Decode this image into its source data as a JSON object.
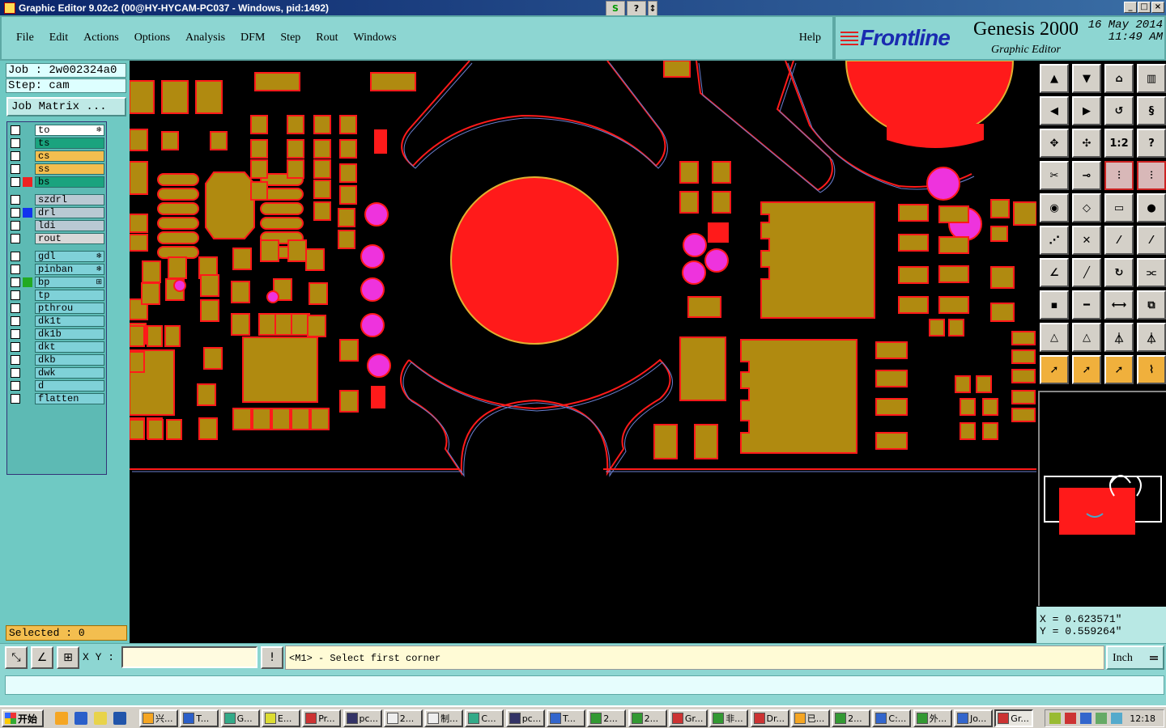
{
  "window": {
    "title": "Graphic Editor 9.02c2 (00@HY-HYCAM-PC037 - Windows, pid:1492)",
    "tools": [
      "S",
      "?",
      "↕"
    ],
    "controls": [
      "_",
      "□",
      "×"
    ]
  },
  "menu": {
    "items": [
      "File",
      "Edit",
      "Actions",
      "Options",
      "Analysis",
      "DFM",
      "Step",
      "Rout",
      "Windows"
    ],
    "help": "Help"
  },
  "brand": {
    "logo": "Frontline",
    "product": "Genesis 2000",
    "subtitle": "Graphic Editor",
    "date": "16 May 2014",
    "time": "11:49 AM"
  },
  "job": {
    "job_line": "Job : 2w002324a0",
    "step_line": "Step: cam",
    "matrix_button": "Job Matrix ..."
  },
  "layers": {
    "group1": [
      {
        "name": "to",
        "color": "#ffffff",
        "mark": "",
        "glyph": "❄"
      },
      {
        "name": "ts",
        "color": "#1aa37e",
        "mark": "",
        "glyph": ""
      },
      {
        "name": "cs",
        "color": "#f3be4f",
        "mark": "",
        "glyph": ""
      },
      {
        "name": "ss",
        "color": "#f3be4f",
        "mark": "",
        "glyph": ""
      },
      {
        "name": "bs",
        "color": "#1aa37e",
        "mark": "#ee2222",
        "glyph": ""
      }
    ],
    "group2": [
      {
        "name": "szdrl",
        "color": "#b9c9d3",
        "mark": "",
        "glyph": ""
      },
      {
        "name": "drl",
        "color": "#b9c9d3",
        "mark": "#1133ee",
        "glyph": ""
      },
      {
        "name": "ldi",
        "color": "#b9c9d3",
        "mark": "",
        "glyph": ""
      },
      {
        "name": "rout",
        "color": "#d8d8d8",
        "mark": "",
        "glyph": ""
      }
    ],
    "group3": [
      {
        "name": "gdl",
        "color": "#7fd1d8",
        "mark": "",
        "glyph": "❄"
      },
      {
        "name": "pinban",
        "color": "#7fd1d8",
        "mark": "",
        "glyph": "❄"
      },
      {
        "name": "bp",
        "color": "#7fd1d8",
        "mark": "#22aa22",
        "glyph": "⊞"
      },
      {
        "name": "tp",
        "color": "#7fd1d8",
        "mark": "",
        "glyph": ""
      },
      {
        "name": "pthrou",
        "color": "#7fd1d8",
        "mark": "",
        "glyph": ""
      },
      {
        "name": "dk1t",
        "color": "#7fd1d8",
        "mark": "",
        "glyph": ""
      },
      {
        "name": "dk1b",
        "color": "#7fd1d8",
        "mark": "",
        "glyph": ""
      },
      {
        "name": "dkt",
        "color": "#7fd1d8",
        "mark": "",
        "glyph": ""
      },
      {
        "name": "dkb",
        "color": "#7fd1d8",
        "mark": "",
        "glyph": ""
      },
      {
        "name": "dwk",
        "color": "#7fd1d8",
        "mark": "",
        "glyph": ""
      },
      {
        "name": "d",
        "color": "#7fd1d8",
        "mark": "",
        "glyph": ""
      },
      {
        "name": "flatten",
        "color": "#7fd1d8",
        "mark": "",
        "glyph": ""
      }
    ]
  },
  "status": {
    "selected": "Selected : 0",
    "x": "X = 0.623571\"",
    "y": "Y = 0.559264\""
  },
  "command": {
    "xy_label": "X Y :",
    "xy_value": "",
    "prompt": "<M1> - Select first corner",
    "unit": "Inch"
  },
  "colors": {
    "pad": "#b08a10",
    "outline": "#ff1a1a",
    "via": "#ee33dd",
    "panel": "#8dd6d2"
  },
  "taskbar": {
    "start": "开始",
    "tasks": [
      "兴...",
      "T...",
      "G...",
      "E...",
      "Pr...",
      "pc...",
      "2...",
      "制...",
      "C...",
      "pc...",
      "T...",
      "2...",
      "2...",
      "Gr...",
      "非...",
      "Dr...",
      "已...",
      "2...",
      "C:...",
      "外...",
      "Jo...",
      "Gr..."
    ],
    "clock": "12:18"
  }
}
